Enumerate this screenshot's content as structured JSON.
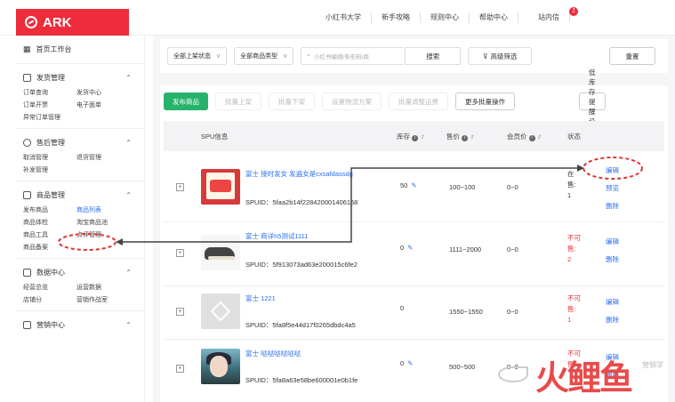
{
  "brand": {
    "name": "ARK"
  },
  "topnav": [
    "小红书大学",
    "新手攻略",
    "规则中心",
    "帮助中心",
    "站内信"
  ],
  "topnav_badge": "1",
  "sidebar": {
    "home": "首页工作台",
    "groups": [
      {
        "title": "发货管理",
        "items": [
          "订单查询",
          "发货中心",
          "订单开票",
          "电子面单",
          "异常订单管理"
        ]
      },
      {
        "title": "售后管理",
        "items": [
          "取消管理",
          "退货管理",
          "补发管理"
        ]
      },
      {
        "title": "商品管理",
        "items": [
          "发布商品",
          "商品列表",
          "商品体检",
          "淘宝商品池",
          "商品工具",
          "点评管理",
          "商品备案"
        ]
      },
      {
        "title": "数据中心",
        "items": [
          "经营总览",
          "运营数据",
          "店铺分",
          "营销作战室"
        ]
      },
      {
        "title": "营销中心",
        "items": []
      }
    ]
  },
  "filters": {
    "status_select": "全部上架状态",
    "type_select": "全部商品类型",
    "search_placeholder": "小红书编辑/条形码/商",
    "search_button": "搜索",
    "advanced_button": "高级筛选",
    "reset_button": "重置"
  },
  "actions": {
    "publish": "发布商品",
    "batch_on": "批量上架",
    "batch_off": "批量下架",
    "logistics": "设置物流方案",
    "batch_shipping": "批量调整运费",
    "more_batch": "更多批量操作",
    "low_stock": "低库存提醒设置"
  },
  "table": {
    "headers": {
      "spu": "SPU信息",
      "stock": "库存",
      "price": "售价",
      "member": "会员价",
      "status": "状态"
    },
    "rows": [
      {
        "name": "富士 接时发女 发遍女是cxsafdassdg",
        "spuid": "SPUID：5faa2b14f228420001406168",
        "stock": "50",
        "price": "100~100",
        "member": "0~0",
        "status": "在售: 1",
        "status_lines": [
          "在",
          "售:",
          "1"
        ],
        "ops": [
          "编辑",
          "预览",
          "删除"
        ]
      },
      {
        "name": "富士 商详h5测试1111",
        "spuid": "SPUID：5f913073ad63e200015c6fe2",
        "stock": "0",
        "price": "1111~2000",
        "member": "0~0",
        "status": "不可售: 2",
        "status_lines": [
          "不可",
          "售:",
          "2"
        ],
        "ops": [
          "编辑",
          "删除"
        ]
      },
      {
        "name": "富士 1221",
        "spuid": "SPUID：5fa8f5e44d17f0265dbdc4a5",
        "stock": "0",
        "price": "1550~1550",
        "member": "0~0",
        "status": "不可售: 1",
        "status_lines": [
          "不可",
          "售:",
          "1"
        ],
        "ops": [
          "编辑",
          "删除"
        ]
      },
      {
        "name": "富士 哒哒哒哒哒哒",
        "spuid": "SPUID：5fa8a63e58be600001e0b1fe",
        "stock": "0",
        "price": "500~500",
        "member": "0~0",
        "status": "不可售",
        "status_lines": [
          "不可",
          "售:"
        ],
        "ops": [
          "编辑",
          "删除"
        ]
      }
    ]
  },
  "watermark": {
    "logo": "火鲤鱼",
    "small": "营销学"
  },
  "colors": {
    "brand": "#ee2c3c",
    "primary_button": "#27b36b",
    "link": "#2b6ef0",
    "annotation": "#e33333"
  }
}
